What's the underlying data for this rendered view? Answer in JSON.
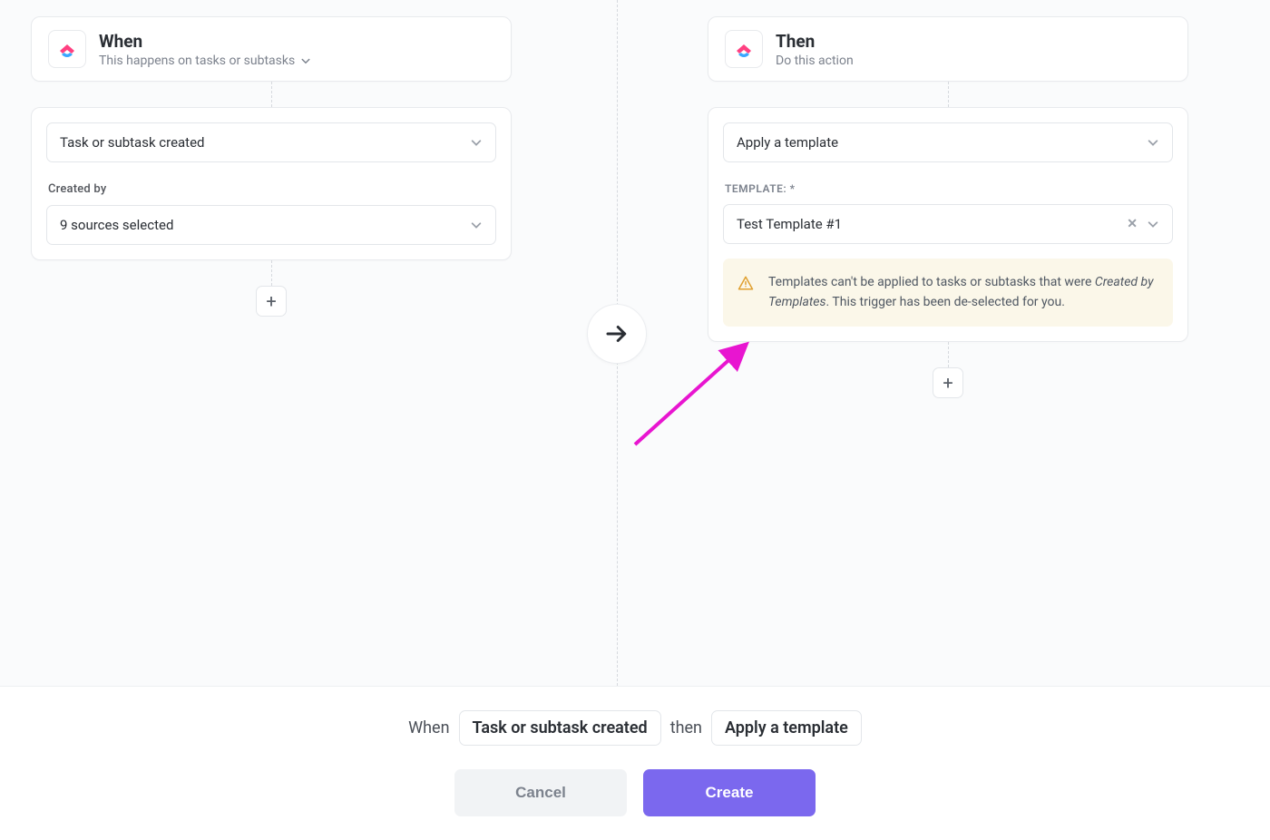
{
  "when": {
    "title": "When",
    "subtitle": "This happens on tasks or subtasks",
    "trigger_select": "Task or subtask created",
    "filter_label": "Created by",
    "filter_select": "9 sources selected"
  },
  "then": {
    "title": "Then",
    "subtitle": "Do this action",
    "action_select": "Apply a template",
    "template_label": "TEMPLATE: *",
    "template_select": "Test Template #1",
    "warning_pre": "Templates can't be applied to tasks or subtasks that were ",
    "warning_em": "Created by Templates",
    "warning_post": ". This trigger has been de-selected for you."
  },
  "footer": {
    "when_text": "When",
    "when_pill": "Task or subtask created",
    "then_text": "then",
    "then_pill": "Apply a template",
    "cancel": "Cancel",
    "create": "Create"
  },
  "icons": {
    "plus": "+"
  }
}
